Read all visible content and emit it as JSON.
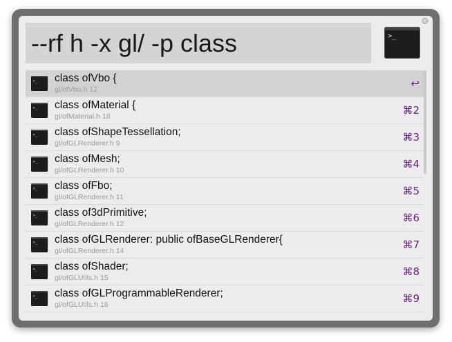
{
  "search": {
    "query": "--rf h -x gl/ -p class"
  },
  "icons": {
    "app": "terminal-icon",
    "settings": "gear-icon",
    "enter": "return-arrow-icon"
  },
  "colors": {
    "shortcut": "#6b1c8a",
    "selected_row": "#d2d2d2",
    "query_bg": "#d4d4d4"
  },
  "results": [
    {
      "title": "class ofVbo {",
      "subtitle": "gl/ofVbo.h 12",
      "shortcut": "↩"
    },
    {
      "title": "class ofMaterial {",
      "subtitle": "gl/ofMaterial.h 18",
      "shortcut": "⌘2"
    },
    {
      "title": "class ofShapeTessellation;",
      "subtitle": "gl/ofGLRenderer.h 9",
      "shortcut": "⌘3"
    },
    {
      "title": "class ofMesh;",
      "subtitle": "gl/ofGLRenderer.h 10",
      "shortcut": "⌘4"
    },
    {
      "title": "class ofFbo;",
      "subtitle": "gl/ofGLRenderer.h 11",
      "shortcut": "⌘5"
    },
    {
      "title": "class of3dPrimitive;",
      "subtitle": "gl/ofGLRenderer.h 12",
      "shortcut": "⌘6"
    },
    {
      "title": "class ofGLRenderer: public ofBaseGLRenderer{",
      "subtitle": "gl/ofGLRenderer.h 14",
      "shortcut": "⌘7"
    },
    {
      "title": "class ofShader;",
      "subtitle": "gl/ofGLUtils.h 15",
      "shortcut": "⌘8"
    },
    {
      "title": "class ofGLProgrammableRenderer;",
      "subtitle": "gl/ofGLUtils.h 16",
      "shortcut": "⌘9"
    }
  ]
}
